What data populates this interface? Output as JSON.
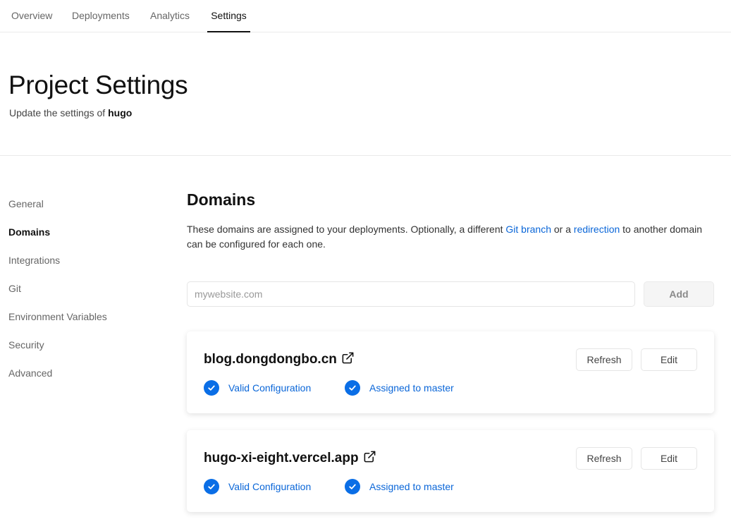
{
  "topnav": {
    "tabs": [
      {
        "label": "Overview"
      },
      {
        "label": "Deployments"
      },
      {
        "label": "Analytics"
      },
      {
        "label": "Settings",
        "active": true
      }
    ]
  },
  "header": {
    "title": "Project Settings",
    "subtitle_prefix": "Update the settings of",
    "project_name": "hugo"
  },
  "sidenav": {
    "items": [
      {
        "label": "General"
      },
      {
        "label": "Domains",
        "active": true
      },
      {
        "label": "Integrations"
      },
      {
        "label": "Git"
      },
      {
        "label": "Environment Variables"
      },
      {
        "label": "Security"
      },
      {
        "label": "Advanced"
      }
    ]
  },
  "domains": {
    "heading": "Domains",
    "description": {
      "part1": "These domains are assigned to your deployments. Optionally, a different",
      "link1": "Git branch",
      "part2": "or a",
      "link2": "redirection",
      "part3": "to another domain can be configured for each one."
    },
    "input_placeholder": "mywebsite.com",
    "input_value": "",
    "add_label": "Add",
    "list": [
      {
        "name": "blog.dongdongbo.cn",
        "refresh_label": "Refresh",
        "edit_label": "Edit",
        "status1": "Valid Configuration",
        "status2": "Assigned to master"
      },
      {
        "name": "hugo-xi-eight.vercel.app",
        "refresh_label": "Refresh",
        "edit_label": "Edit",
        "status1": "Valid Configuration",
        "status2": "Assigned to master"
      }
    ]
  },
  "icons": {
    "external_link": "external-link-icon",
    "check": "check-circle-icon"
  },
  "colors": {
    "accent": "#0a66d8",
    "check_fill": "#0a6ee6",
    "border": "#eaeaea"
  }
}
